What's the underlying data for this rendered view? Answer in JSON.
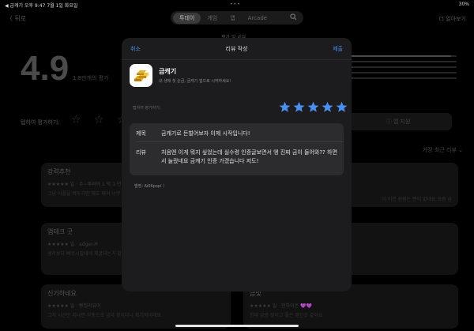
{
  "status_bar": {
    "left": "◀ 금캐기  오후 9:47  7월 1일 화요일",
    "dots": "•••",
    "right": "30%"
  },
  "nav": {
    "back": "〈 뒤로",
    "tabs": [
      "투데이",
      "게임",
      "앱",
      "Arcade"
    ],
    "active_tab": "투데이",
    "search_icon": "search-icon",
    "more": "더 알아보기",
    "under_title": "평가 및 리뷰"
  },
  "background": {
    "rating": "4.9",
    "rating_count": "1.8만개의 평가",
    "tap_to_rate": "탭하여 평가하기:",
    "tap_stars": "☆ ☆ ☆",
    "support": "ⓘ 앱 지원",
    "sort": "가장 최근 리뷰 ⌄",
    "bar_fractions": [
      0.95,
      0.05,
      0.02,
      0.01,
      0.02
    ],
    "reviews": [
      {
        "title": "강력추천",
        "meta": "★★★★★ 일 · 수~루려아 1 막 1 년",
        "body": "그냥 어플을 켜두기만 해도 돼서 너무 편해요",
        "side": "이 이런 원원는 뻔이 없네요 요즘 금"
      },
      {
        "title": "앱테크 굿",
        "meta": "★★★★★ 일 · adger-H",
        "body": "생각보다 빠르시밀내에 채굴되는거 같아요 사용도 간식해서 더욱더 좋습니다",
        "side": ""
      },
      {
        "title": "신기하네요",
        "meta": "★★★★★ 일 · 빵집리뷰어",
        "body": "그저 시간만 지나면 자동으로 금이 쌓이다니 획기적이에요",
        "side_title": "금빛",
        "side_meta": "★★★★★ 일 · 안하이은 💜💜",
        "side_body": "진짜 금방 쌓이고 좋은 앱인것 같아요"
      }
    ]
  },
  "modal": {
    "cancel": "취소",
    "title": "리뷰 작성",
    "submit": "제출",
    "app_name": "금캐기",
    "app_subtitle": "내 생애 첫 순금, 금캐기 앱으로 시작하세요!",
    "tap_to_rate": "탭하여 평가하기:",
    "rating": 5,
    "star_color": "#4a90f0",
    "title_label": "제목",
    "title_value": "금캐기로 돈벌어보자 이제 시작입니다!",
    "review_label": "리뷰",
    "review_value": "처음엔 이게 뭐지 싶었는데 실수령 인증글보면서 엥 진짜 금이 들어와?? 하면서 놀랐네요 금캐기 인증 가겠습니다 저도!",
    "nickname": "별명: Ai06popi 〉"
  }
}
